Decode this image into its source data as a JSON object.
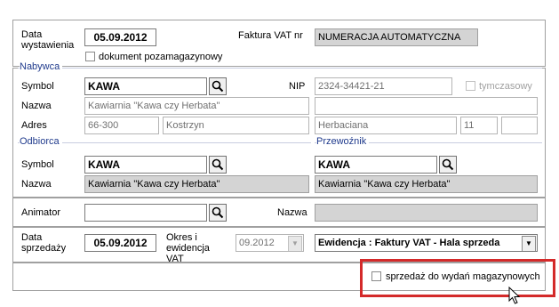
{
  "document": {
    "date_label": "Data\nwystawienia",
    "date_value": "05.09.2012",
    "invoice_nr_label": "Faktura VAT nr",
    "invoice_nr_value": "NUMERACJA AUTOMATYCZNA",
    "non_warehouse_label": "dokument pozamagazynowy"
  },
  "buyer": {
    "group_label": "Nabywca",
    "symbol_label": "Symbol",
    "symbol_value": "KAWA",
    "nip_label": "NIP",
    "nip_value": "2324-34421-21",
    "temporary_label": "tymczasowy",
    "name_label": "Nazwa",
    "name_value": "Kawiarnia \"Kawa czy Herbata\"",
    "name_value_2": "",
    "address_label": "Adres",
    "postal_code": "66-300",
    "city": "Kostrzyn",
    "street": "Herbaciana",
    "house_nr": "11",
    "flat_nr": ""
  },
  "recipient": {
    "group_label": "Odbiorca",
    "symbol_label": "Symbol",
    "symbol_value": "KAWA",
    "name_label": "Nazwa",
    "name_value": "Kawiarnia \"Kawa czy Herbata\""
  },
  "carrier": {
    "group_label": "Przewoźnik",
    "symbol_value": "KAWA",
    "name_value": "Kawiarnia \"Kawa czy Herbata\""
  },
  "animator": {
    "label": "Animator",
    "value": "",
    "name_label": "Nazwa",
    "name_value": ""
  },
  "sale": {
    "date_label": "Data\nsprzedaży",
    "date_value": "05.09.2012",
    "period_label": "Okres i\newidencja VAT",
    "period_value": "09.2012",
    "register_value": "Ewidencja : Faktury VAT - Hala sprzeda"
  },
  "footer": {
    "sale_for_issues_label": "sprzedaż do wydań magazynowych"
  },
  "colors": {
    "group_label": "#1f3a8c",
    "highlight_box": "#d42a2a",
    "disabled_field": "#d4d4d4"
  }
}
